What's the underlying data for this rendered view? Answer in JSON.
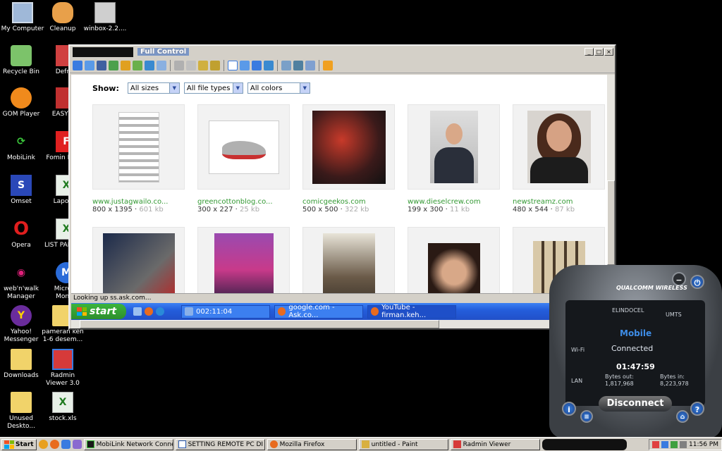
{
  "desktop": {
    "icons": [
      {
        "label": "My Computer"
      },
      {
        "label": "Recycle Bin"
      },
      {
        "label": "GOM Player"
      },
      {
        "label": "MobiLink"
      },
      {
        "label": "Omset"
      },
      {
        "label": "Opera"
      },
      {
        "label": "web'n'walk Manager"
      },
      {
        "label": "Yahoo! Messenger"
      },
      {
        "label": "Downloads"
      },
      {
        "label": "Unused Deskto..."
      },
      {
        "label": "Cleanup"
      },
      {
        "label": "Defrag"
      },
      {
        "label": "EASYTEC"
      },
      {
        "label": "Fomin NetSe"
      },
      {
        "label": "Laporan"
      },
      {
        "label": "LIST PAKETAN"
      },
      {
        "label": "Microso Money"
      },
      {
        "label": "pameran ken 1-6 desem..."
      },
      {
        "label": "Radmin Viewer 3.0"
      },
      {
        "label": "stock.xls"
      },
      {
        "label": "winbox-2.2...."
      }
    ]
  },
  "remote_window": {
    "title": "Full Control",
    "status_text": "Looking up ss.ask.com...",
    "filters": {
      "show_label": "Show:",
      "size": "All sizes",
      "file_type": "All file types",
      "color": "All colors"
    },
    "results": [
      {
        "domain": "www.justagwailo.co...",
        "dims": "800 x 1395",
        "kb": "601 kb"
      },
      {
        "domain": "greencottonblog.co...",
        "dims": "300 x 227",
        "kb": "25 kb"
      },
      {
        "domain": "comicgeekos.com",
        "dims": "500 x 500",
        "kb": "322 kb"
      },
      {
        "domain": "www.dieselcrew.com",
        "dims": "199 x 300",
        "kb": "11 kb"
      },
      {
        "domain": "newstreamz.com",
        "dims": "480 x 544",
        "kb": "87 kb"
      }
    ],
    "remote_taskbar": {
      "start": "start",
      "tasks": [
        {
          "label": "002:11:04"
        },
        {
          "label": "google.com - Ask.co..."
        },
        {
          "label": "YouTube - firman.keh..."
        }
      ]
    }
  },
  "dialer": {
    "brand": "QUALCOMM WIRELESS",
    "network": "ELINDOCEL",
    "umts": "UMTS",
    "mode": "Mobile",
    "status": "Connected",
    "time": "01:47:59",
    "wifi": "Wi-Fi",
    "lan": "LAN",
    "bytes_out_label": "Bytes out:",
    "bytes_out": "1,817,968",
    "bytes_in_label": "Bytes in:",
    "bytes_in": "8,223,978",
    "button": "Disconnect"
  },
  "taskbar": {
    "start": "Start",
    "items": [
      {
        "label": "MobiLink Network Conne..."
      },
      {
        "label": "SETTING REMOTE PC DI ..."
      },
      {
        "label": "Mozilla Firefox"
      },
      {
        "label": "untitled - Paint"
      },
      {
        "label": "Radmin Viewer"
      }
    ],
    "clock": "11:56 PM"
  }
}
